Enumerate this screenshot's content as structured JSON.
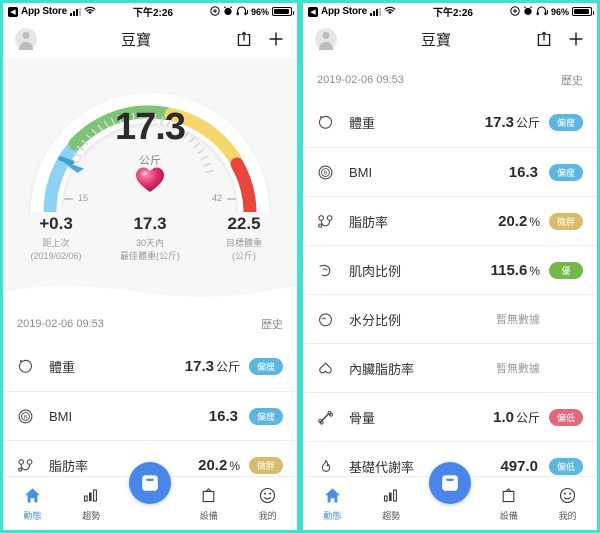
{
  "theme": {
    "frame_color": "#3fe0d0",
    "accent_blue": "#4a86e8",
    "badge_blue": "#5bb7e0",
    "badge_gold": "#d9bb6a",
    "badge_green": "#74b84a",
    "badge_red": "#e0697c",
    "gauge_blue": "#8ed3f2",
    "gauge_green": "#7cc576",
    "gauge_yellow": "#f5d76e",
    "gauge_red": "#e8453c"
  },
  "status_bar": {
    "back_glyph": "◀",
    "app_name": "App Store",
    "signal_icon": "cellular-signal-icon",
    "wifi_icon": "wifi-icon",
    "time": "下午2:26",
    "location_icon": "location-icon",
    "alarm_icon": "alarm-icon",
    "headphones_icon": "headphones-icon",
    "battery_percent": "96%",
    "battery_icon": "battery-icon"
  },
  "nav": {
    "avatar_icon": "avatar-icon",
    "title": "豆寶",
    "share_icon": "share-icon",
    "add_icon": "plus-icon"
  },
  "gauge": {
    "value": "17.3",
    "unit": "公斤",
    "min_label": "15",
    "max_label": "42",
    "heart_icon": "heart-icon",
    "pointer_icon": "gauge-pointer-icon"
  },
  "stats": [
    {
      "value": "+0.3",
      "label_line1": "距上次",
      "label_line2": "(2019/02/06)"
    },
    {
      "value": "17.3",
      "label_line1": "30天內",
      "label_line2": "最佳體重(公斤)"
    },
    {
      "value": "22.5",
      "label_line1": "目標體重",
      "label_line2": "(公斤)"
    }
  ],
  "list_header": {
    "date": "2019-02-06 09:53",
    "history_label": "歷史"
  },
  "rows": [
    {
      "icon": "weight-drop-icon",
      "label": "體重",
      "value": "17.3",
      "unit": "公斤",
      "badge": "偏瘦",
      "badge_color": "#5bb7e0"
    },
    {
      "icon": "bmi-circle-icon",
      "label": "BMI",
      "value": "16.3",
      "unit": "",
      "badge": "偏瘦",
      "badge_color": "#5bb7e0"
    },
    {
      "icon": "body-fat-icon",
      "label": "脂肪率",
      "value": "20.2",
      "unit": "%",
      "badge": "微胖",
      "badge_color": "#d9bb6a"
    },
    {
      "icon": "muscle-arm-icon",
      "label": "肌肉比例",
      "value": "115.6",
      "unit": "%",
      "badge": "優",
      "badge_color": "#74b84a"
    },
    {
      "icon": "water-drop-icon",
      "label": "水分比例",
      "value": "暫無數據",
      "unit": "",
      "badge": "",
      "badge_color": ""
    },
    {
      "icon": "visceral-fat-icon",
      "label": "內臟脂肪率",
      "value": "暫無數據",
      "unit": "",
      "badge": "",
      "badge_color": ""
    },
    {
      "icon": "bone-icon",
      "label": "骨量",
      "value": "1.0",
      "unit": "公斤",
      "badge": "偏低",
      "badge_color": "#e0697c"
    },
    {
      "icon": "flame-icon",
      "label": "基礎代謝率",
      "value": "497.0",
      "unit": "",
      "badge": "偏低",
      "badge_color": "#5bb7e0"
    }
  ],
  "tabs": [
    {
      "icon": "home-icon",
      "label": "動態",
      "active": true,
      "center": false
    },
    {
      "icon": "chart-bar-icon",
      "label": "趨勢",
      "active": false,
      "center": false
    },
    {
      "icon": "scale-icon",
      "label": "上秤",
      "active": false,
      "center": true
    },
    {
      "icon": "clipboard-icon",
      "label": "設備",
      "active": false,
      "center": false
    },
    {
      "icon": "smiley-icon",
      "label": "我的",
      "active": false,
      "center": false
    }
  ],
  "right_panel": {
    "visible_rows_start": 0,
    "scroll_state": "list-expanded"
  }
}
